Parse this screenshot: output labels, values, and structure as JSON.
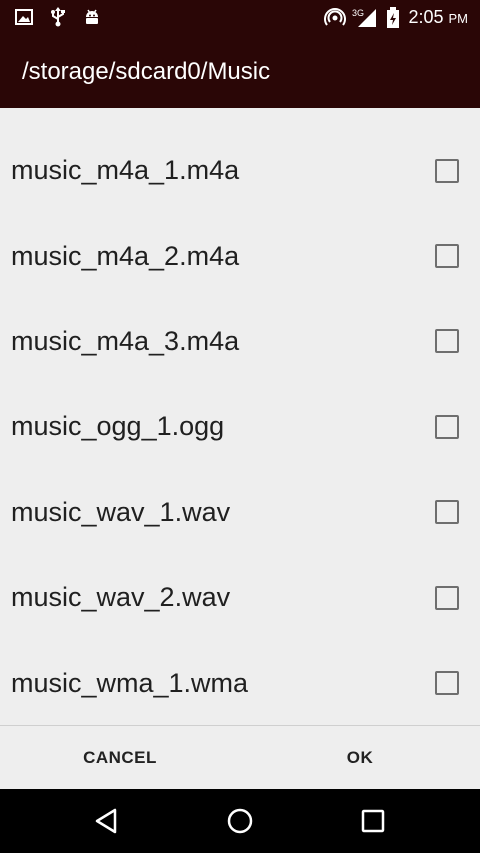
{
  "status_bar": {
    "time": "2:05",
    "ampm": "PM",
    "network": "3G",
    "icons_left": [
      "image-icon",
      "usb-icon",
      "android-debug-icon"
    ],
    "icons_right": [
      "hotspot-icon",
      "signal-icon",
      "battery-icon"
    ]
  },
  "header": {
    "title": "/storage/sdcard0/Music"
  },
  "files": [
    {
      "name": "music_m4a_1.m4a",
      "checked": false
    },
    {
      "name": "music_m4a_2.m4a",
      "checked": false
    },
    {
      "name": "music_m4a_3.m4a",
      "checked": false
    },
    {
      "name": "music_ogg_1.ogg",
      "checked": false
    },
    {
      "name": "music_wav_1.wav",
      "checked": false
    },
    {
      "name": "music_wav_2.wav",
      "checked": false
    },
    {
      "name": "music_wma_1.wma",
      "checked": false
    }
  ],
  "buttons": {
    "cancel": "CANCEL",
    "ok": "OK"
  },
  "colors": {
    "header_bg": "#2a0606",
    "content_bg": "#eeeeee",
    "text": "#202020"
  }
}
